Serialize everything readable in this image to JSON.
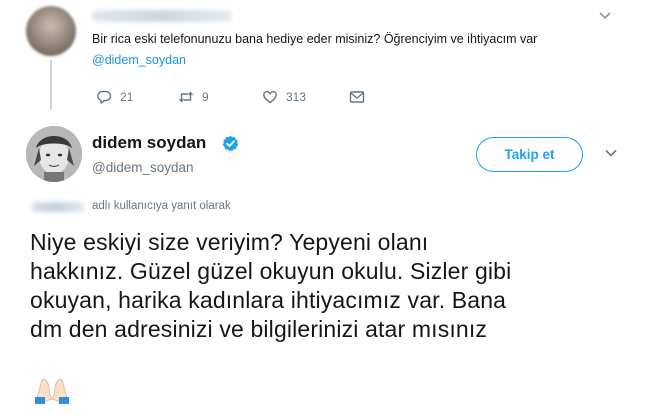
{
  "top_tweet": {
    "text": "Bir rica eski telefonunuzu bana hediye eder misiniz? Öğrenciyim ve ihtiyacım var",
    "mention": "@didem_soydan",
    "stats": {
      "replies": "21",
      "retweets": "9",
      "likes": "313"
    }
  },
  "main_tweet": {
    "display_name": "didem soydan",
    "handle": "@didem_soydan",
    "follow_label": "Takip et",
    "reply_context": "adlı kullanıcıya yanıt olarak",
    "body_lines": [
      "Niye eskiyi size veriyim? Yepyeni olanı",
      "hakkınız. Güzel güzel okuyun okulu. Sizler gibi",
      "okuyan, harika kadınlara ihtiyacımız var. Bana",
      "dm den adresinizi ve bilgilerinizi atar mısınız"
    ]
  },
  "colors": {
    "accent": "#1da1f2",
    "mention": "#1b95e0",
    "muted": "#657786",
    "text": "#14171a"
  }
}
